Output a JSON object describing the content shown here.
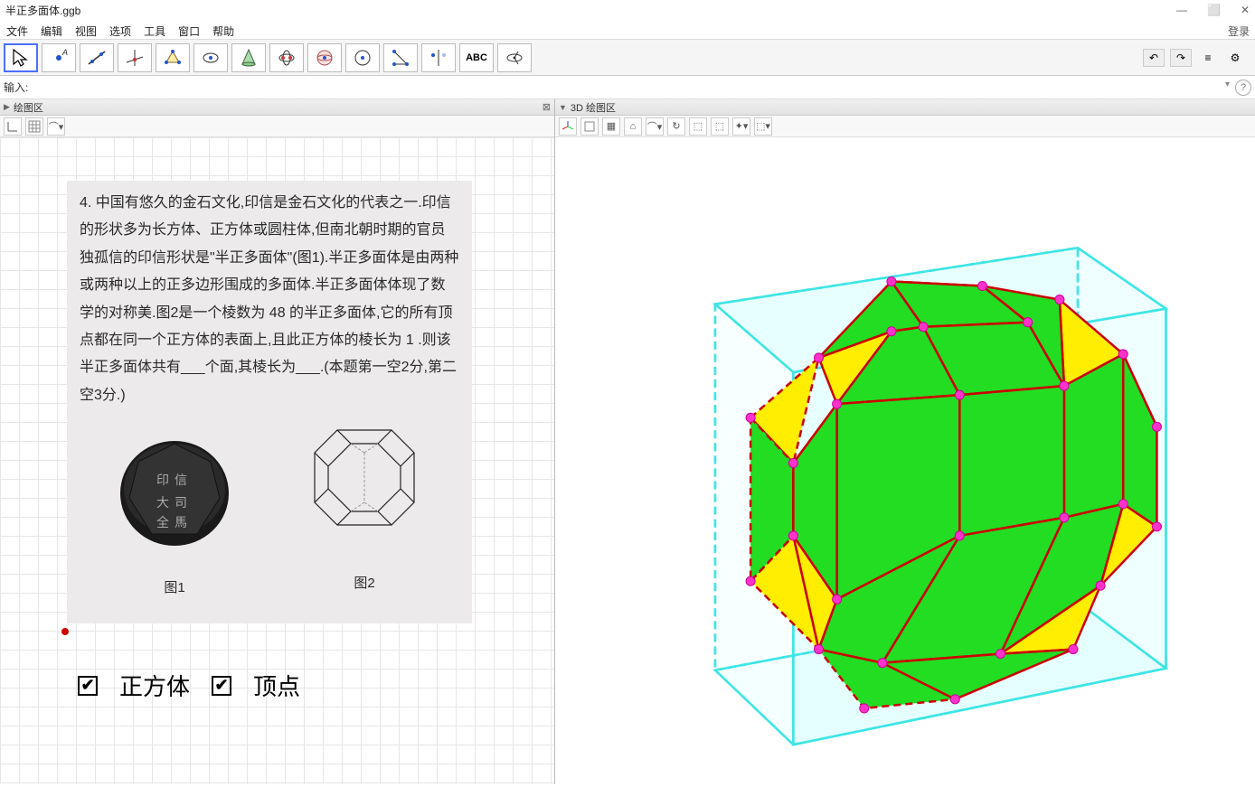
{
  "titlebar": {
    "filename": "半正多面体.ggb",
    "minimize": "—",
    "maximize": "⬜",
    "close": "✕"
  },
  "menubar": {
    "items": [
      "文件",
      "编辑",
      "视图",
      "选项",
      "工具",
      "窗口",
      "帮助"
    ],
    "login": "登录"
  },
  "toolbar": {
    "tools": [
      "move",
      "point",
      "line",
      "perpendicular",
      "polygon",
      "circle",
      "ellipse",
      "conic",
      "angle",
      "reflect",
      "slider",
      "text",
      "rotate-3d"
    ],
    "undo": "↶",
    "redo": "↷",
    "menu": "≡",
    "settings": "⚙"
  },
  "input": {
    "label": "输入:",
    "placeholder": "",
    "menu_icon": "▾",
    "help": "?"
  },
  "panel_left": {
    "title": "绘图区"
  },
  "panel_right": {
    "title": "3D 绘图区"
  },
  "problem": {
    "text": "4.  中国有悠久的金石文化,印信是金石文化的代表之一.印信的形状多为长方体、正方体或圆柱体,但南北朝时期的官员独孤信的印信形状是\"半正多面体\"(图1).半正多面体是由两种或两种以上的正多边形围成的多面体.半正多面体体现了数学的对称美.图2是一个棱数为 48 的半正多面体,它的所有顶点都在同一个正方体的表面上,且此正方体的棱长为 1 .则该半正多面体共有___个面,其棱长为___.(本题第一空2分,第二空3分.)",
    "caption1": "图1",
    "caption2": "图2"
  },
  "checkboxes": {
    "cube_label": "正方体",
    "vertex_label": "顶点"
  }
}
